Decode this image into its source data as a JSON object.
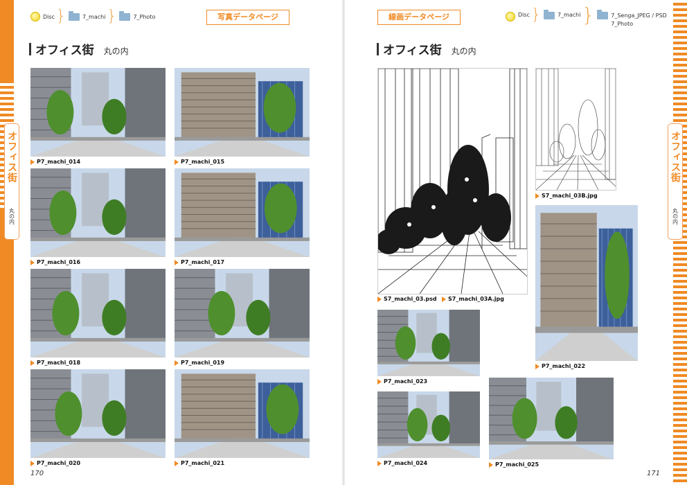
{
  "left_page": {
    "breadcrumb": [
      "Disc",
      "7_machi",
      "7_Photo"
    ],
    "label": "写真データページ",
    "title": "オフィス街",
    "subtitle": "丸の内",
    "side_tab": {
      "title": "オフィス街",
      "subtitle": "丸の内"
    },
    "page_number": "170",
    "photos": [
      {
        "caption": "P7_machi_014",
        "scene": "street"
      },
      {
        "caption": "P7_machi_015",
        "scene": "building"
      },
      {
        "caption": "P7_machi_016",
        "scene": "street"
      },
      {
        "caption": "P7_machi_017",
        "scene": "building"
      },
      {
        "caption": "P7_machi_018",
        "scene": "street"
      },
      {
        "caption": "P7_machi_019",
        "scene": "street"
      },
      {
        "caption": "P7_machi_020",
        "scene": "street"
      },
      {
        "caption": "P7_machi_021",
        "scene": "building"
      }
    ]
  },
  "right_page": {
    "breadcrumb": [
      "Disc",
      "7_machi",
      "7_Senga_JPEG / PSD",
      "7_Photo"
    ],
    "label": "線画データページ",
    "title": "オフィス街",
    "subtitle": "丸の内",
    "side_tab": {
      "title": "オフィス街",
      "subtitle": "丸の内"
    },
    "page_number": "171",
    "line_art": [
      {
        "caption_a": "S7_machi_03.psd",
        "caption_b": "S7_machi_03A.jpg"
      },
      {
        "caption": "S7_machi_03B.jpg"
      }
    ],
    "photos": [
      {
        "caption": "P7_machi_022",
        "scene": "building"
      },
      {
        "caption": "P7_machi_023",
        "scene": "street"
      },
      {
        "caption": "P7_machi_024",
        "scene": "street"
      },
      {
        "caption": "P7_machi_025",
        "scene": "street"
      }
    ]
  },
  "colors": {
    "accent": "#f08a24",
    "sky": "#c8d8ea",
    "tree": "#4f8f2e",
    "building": "#8a8e94"
  }
}
